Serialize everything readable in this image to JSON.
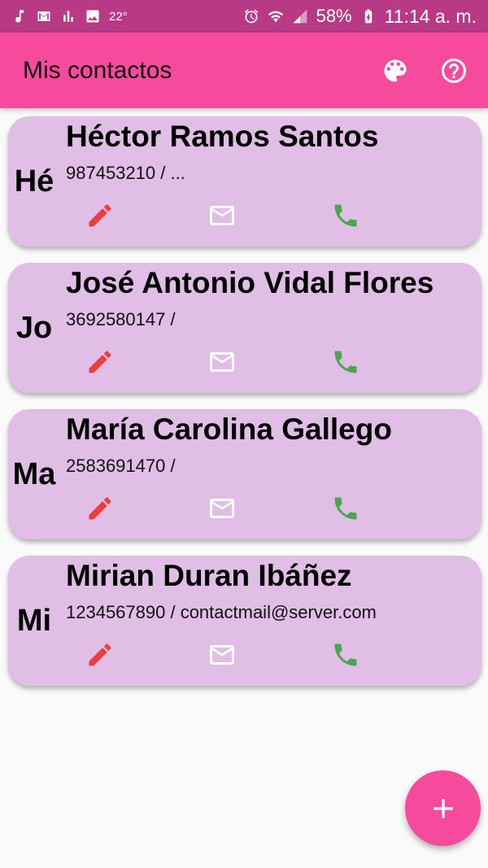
{
  "status_bar": {
    "temperature": "22°",
    "battery": "58%",
    "time": "11:14 a. m."
  },
  "app_bar": {
    "title": "Mis contactos",
    "icons": [
      "palette-icon",
      "help-icon"
    ]
  },
  "contacts": [
    {
      "initials": "Hé",
      "name": "Héctor Ramos Santos",
      "details": "987453210 / ..."
    },
    {
      "initials": "Jo",
      "name": "José Antonio Vidal Flores",
      "details": "3692580147 /"
    },
    {
      "initials": "Ma",
      "name": "María Carolina Gallego",
      "details": "2583691470 /"
    },
    {
      "initials": "Mi",
      "name": "Mirian Duran Ibáñez",
      "details": "1234567890 / contactmail@server.com"
    }
  ],
  "card_actions": [
    "edit-icon",
    "mail-icon",
    "phone-icon"
  ],
  "colors": {
    "status_bar": "#b83a85",
    "app_bar": "#f64a9c",
    "card": "#e0bee6",
    "edit": "#ee3d3d",
    "mail": "#ffffff",
    "call": "#47a84d",
    "fab": "#f64a9c"
  },
  "fab_icon": "add-icon"
}
